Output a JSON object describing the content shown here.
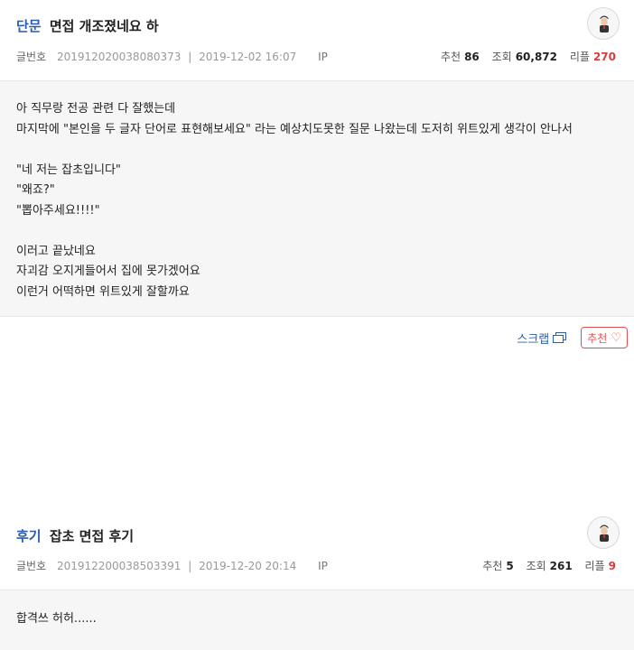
{
  "posts": [
    {
      "category": "단문",
      "title": "면접 개조졌네요 하",
      "meta_label": "글번호",
      "post_number": "201912020038080373",
      "date": "2019-12-02 16:07",
      "ip_label": "IP",
      "stats": {
        "recommend_label": "추천",
        "recommend": "86",
        "views_label": "조회",
        "views": "60,872",
        "replies_label": "리플",
        "replies": "270"
      },
      "body": "아 직무랑 전공 관련 다 잘했는데\n마지막에 \"본인을 두 글자 단어로 표현해보세요\" 라는 예상치도못한 질문 나왔는데 도저히 위트있게 생각이 안나서\n\n\"네 저는 잡초입니다\"\n\"왜죠?\"\n\"뽑아주세요!!!!\"\n\n이러고 끝났네요\n자괴감 오지게들어서 집에 못가겠어요\n이런거 어떡하면 위트있게 잘할까요"
    },
    {
      "category": "후기",
      "title": "잡초 면접 후기",
      "meta_label": "글번호",
      "post_number": "201912200038503391",
      "date": "2019-12-20 20:14",
      "ip_label": "IP",
      "stats": {
        "recommend_label": "추천",
        "recommend": "5",
        "views_label": "조회",
        "views": "261",
        "replies_label": "리플",
        "replies": "9"
      },
      "body": "합격쓰 허허......"
    }
  ],
  "actions": {
    "scrap_label": "스크랩",
    "like_label": "추천"
  },
  "icons": {
    "scrap": "window-stack-icon",
    "like": "heart-outline-icon",
    "avatar": "user-avatar-icon"
  },
  "colors": {
    "category": "#2a5db0",
    "replies": "#d83c3c",
    "like": "#e05252",
    "body_bg": "#f6f6f6"
  }
}
